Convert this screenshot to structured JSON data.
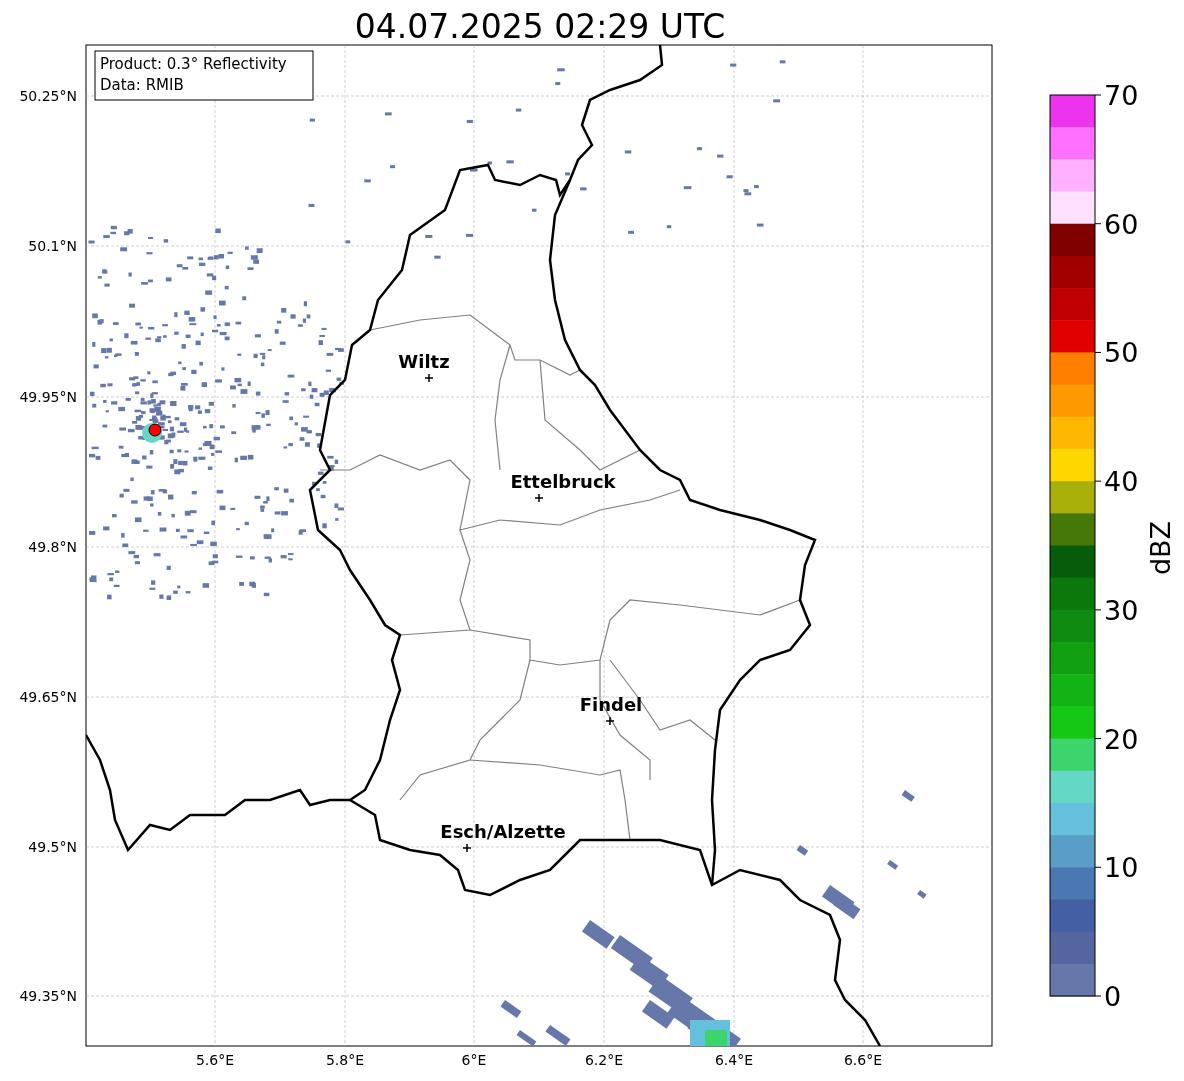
{
  "title": "04.07.2025 02:29 UTC",
  "info_box": [
    "Product: 0.3° Reflectivity",
    "Data: RMIB"
  ],
  "lat_ticks": [
    "50.25°N",
    "50.1°N",
    "49.95°N",
    "49.8°N",
    "49.65°N",
    "49.5°N",
    "49.35°N"
  ],
  "lon_ticks": [
    "5.6°E",
    "5.8°E",
    "6°E",
    "6.2°E",
    "6.4°E",
    "6.6°E"
  ],
  "cities": [
    {
      "name": "Wiltz"
    },
    {
      "name": "Ettelbruck"
    },
    {
      "name": "Findel"
    },
    {
      "name": "Esch/Alzette"
    }
  ],
  "colorbar": {
    "label": "dBZ",
    "ticks": [
      "70",
      "60",
      "50",
      "40",
      "30",
      "20",
      "10",
      "0"
    ],
    "bins": [
      {
        "color": "#ee33ee"
      },
      {
        "color": "#ff70ff"
      },
      {
        "color": "#ffb0ff"
      },
      {
        "color": "#ffe0ff"
      },
      {
        "color": "#800000"
      },
      {
        "color": "#a00000"
      },
      {
        "color": "#c00000"
      },
      {
        "color": "#e00000"
      },
      {
        "color": "#ff7f00"
      },
      {
        "color": "#ff9900"
      },
      {
        "color": "#ffb800"
      },
      {
        "color": "#ffd700"
      },
      {
        "color": "#aab00a"
      },
      {
        "color": "#467808"
      },
      {
        "color": "#065c0a"
      },
      {
        "color": "#0a780a"
      },
      {
        "color": "#0e8c12"
      },
      {
        "color": "#10a010"
      },
      {
        "color": "#12b414"
      },
      {
        "color": "#14c814"
      },
      {
        "color": "#3cd46c"
      },
      {
        "color": "#64d8c4"
      },
      {
        "color": "#64c0dc"
      },
      {
        "color": "#5a9ec8"
      },
      {
        "color": "#4a78b2"
      },
      {
        "color": "#445fa3"
      },
      {
        "color": "#54669f"
      },
      {
        "color": "#6677aa"
      }
    ]
  }
}
